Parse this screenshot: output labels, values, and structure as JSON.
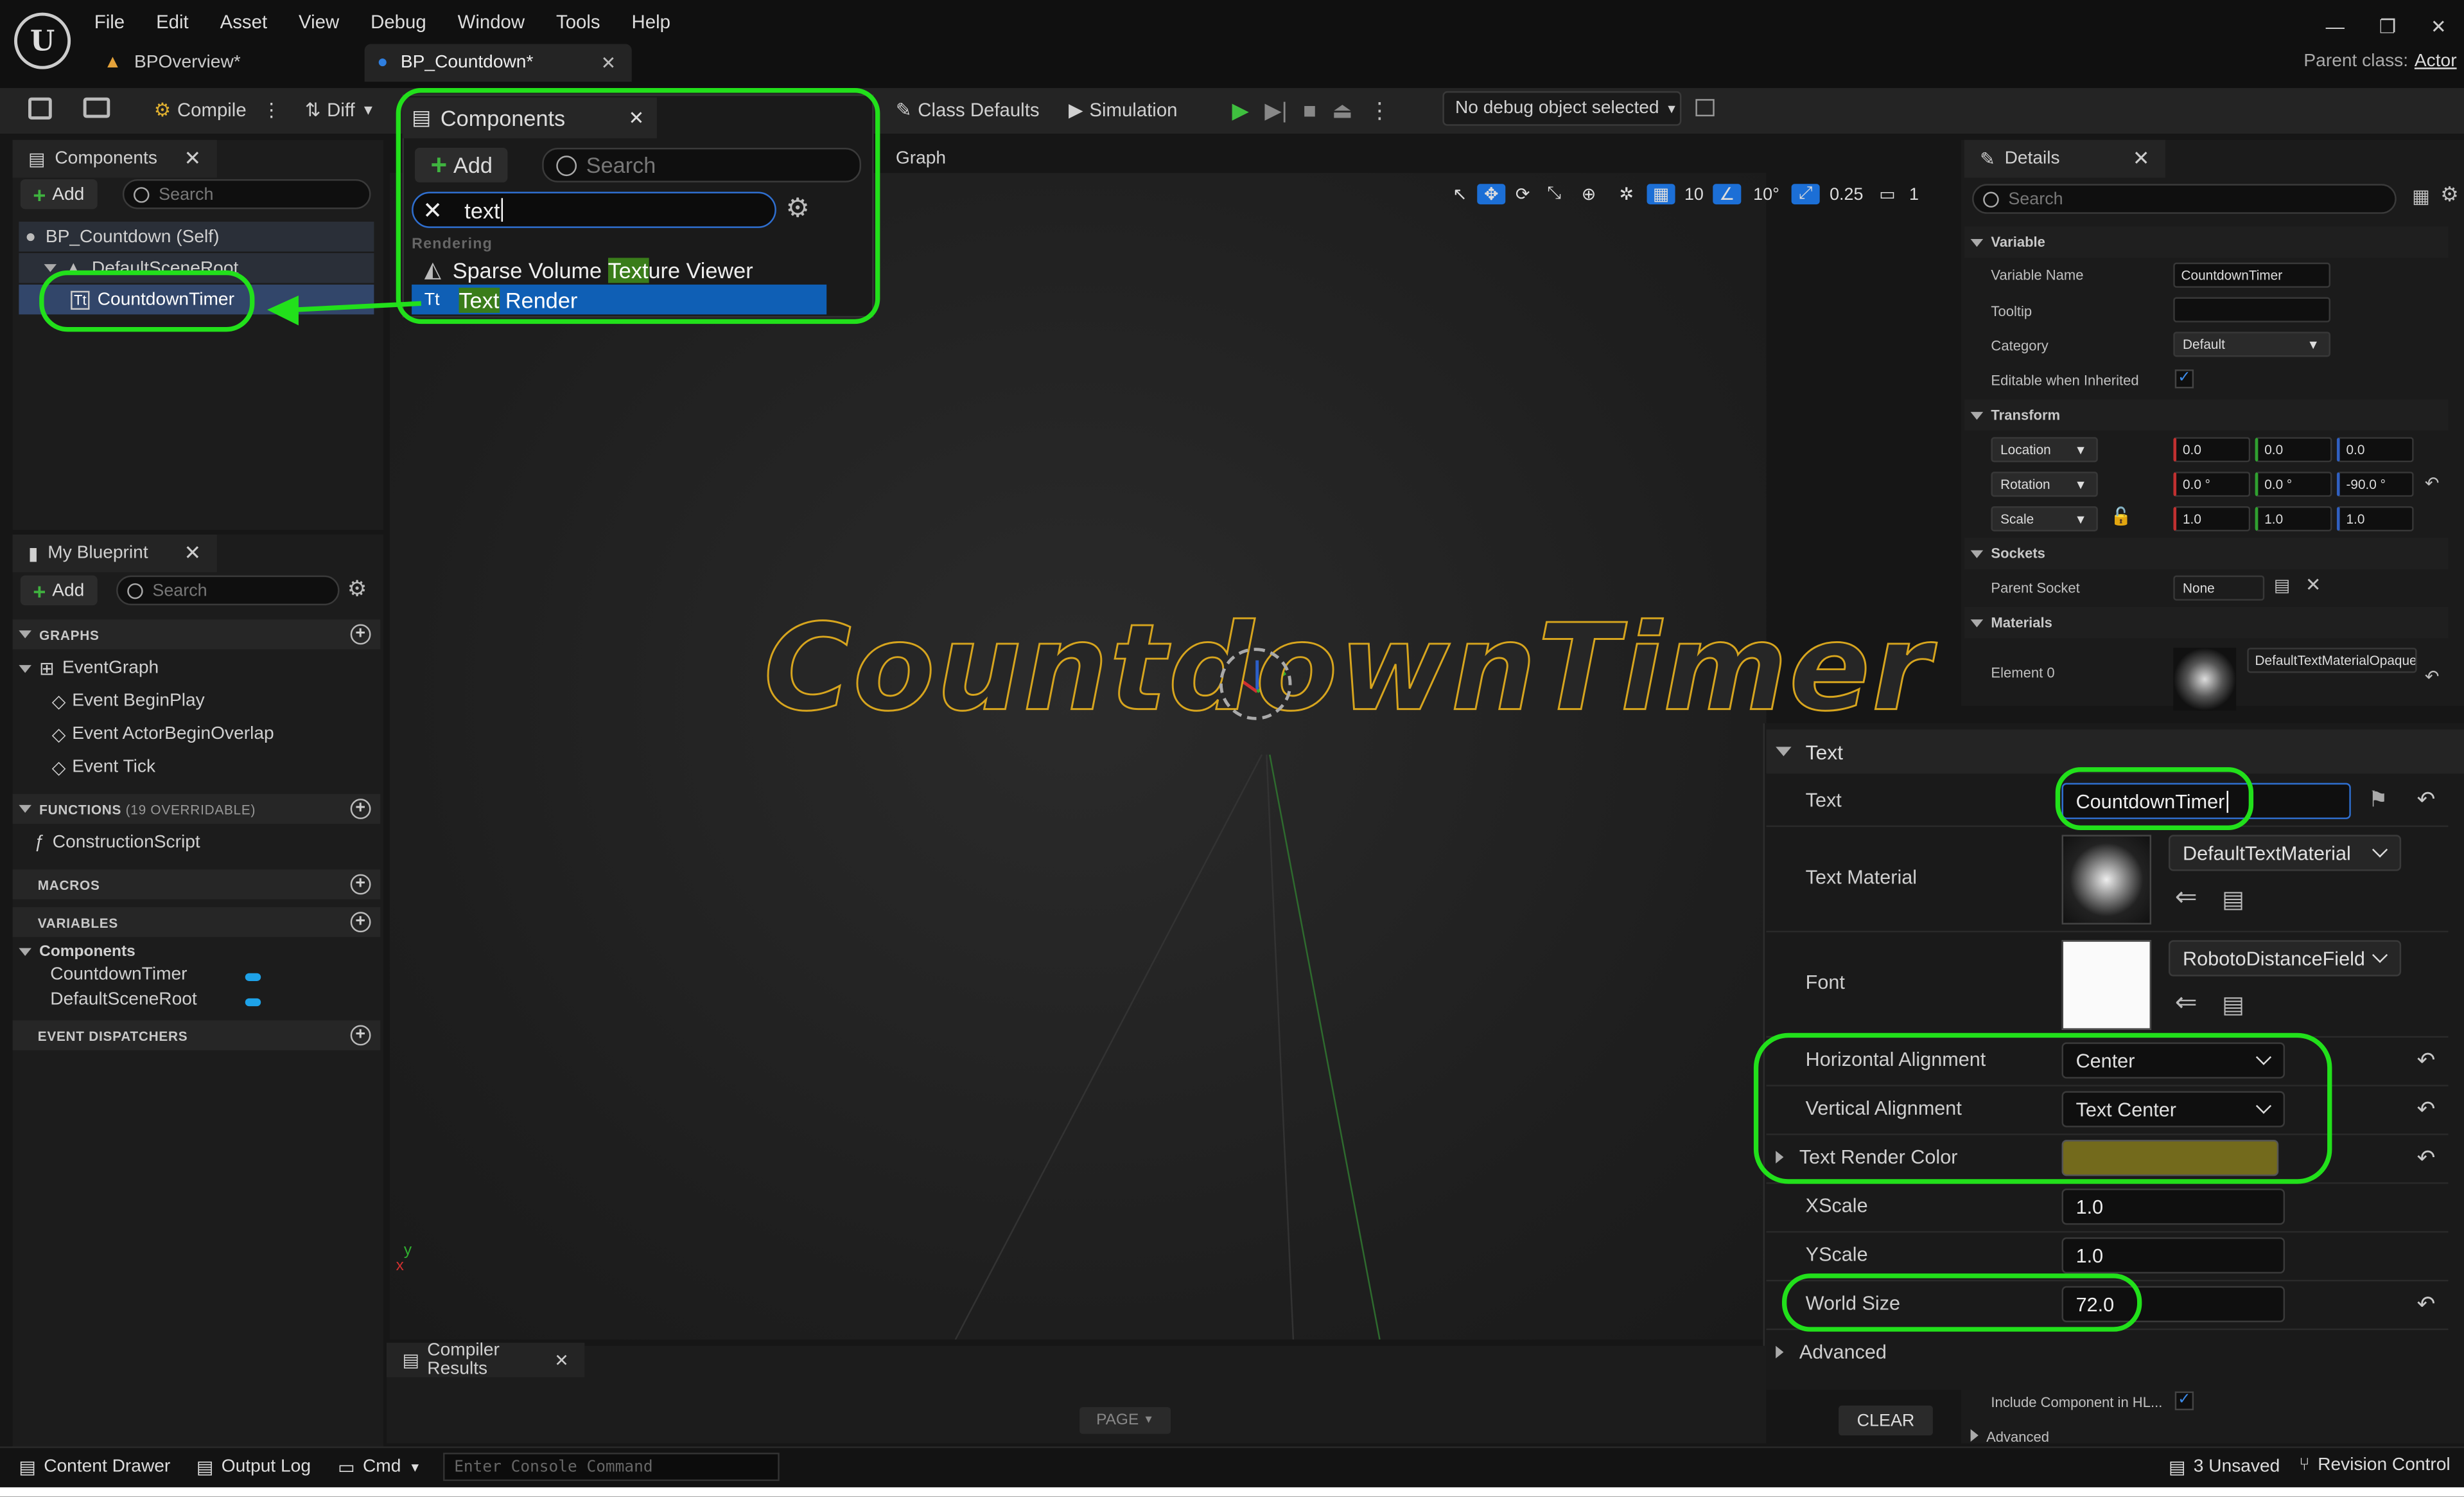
{
  "menu": [
    "File",
    "Edit",
    "Asset",
    "View",
    "Debug",
    "Window",
    "Tools",
    "Help"
  ],
  "tabs": [
    {
      "label": "BPOverview*"
    },
    {
      "label": "BP_Countdown*"
    }
  ],
  "parent_class": {
    "label": "Parent class:",
    "value": "Actor"
  },
  "toolbar": {
    "compile": "Compile",
    "diff": "Diff",
    "class_defaults": "Class Defaults",
    "simulation": "Simulation",
    "debug_object": "No debug object selected"
  },
  "viewport_toolbar": {
    "grid": "10",
    "angle": "10°",
    "scale": "0.25",
    "camera": "1"
  },
  "graph_tab_label": "Graph",
  "components_panel": {
    "title": "Components",
    "add": "Add",
    "search_placeholder": "Search",
    "items": [
      {
        "label": "BP_Countdown (Self)"
      },
      {
        "label": "DefaultSceneRoot"
      },
      {
        "label": "CountdownTimer"
      }
    ]
  },
  "add_popup": {
    "title": "Components",
    "add": "Add",
    "search_placeholder": "Search",
    "filter_text": "text",
    "category": "Rendering",
    "results": [
      {
        "pre": "Sparse Volume ",
        "match": "Text",
        "post": "ure Viewer"
      },
      {
        "pre": "",
        "match": "Text",
        "post": " Render"
      }
    ]
  },
  "my_blueprint": {
    "title": "My Blueprint",
    "add": "Add",
    "search_placeholder": "Search",
    "graphs_header": "GRAPHS",
    "event_graph": "EventGraph",
    "events": [
      "Event BeginPlay",
      "Event ActorBeginOverlap",
      "Event Tick"
    ],
    "functions_header": "FUNCTIONS",
    "functions_count": "(19 OVERRIDABLE)",
    "construction_script": "ConstructionScript",
    "macros_header": "MACROS",
    "variables_header": "VARIABLES",
    "components_header": "Components",
    "variables": [
      "CountdownTimer",
      "DefaultSceneRoot"
    ],
    "dispatchers_header": "EVENT DISPATCHERS"
  },
  "viewport_text": "CountdownTimer",
  "details": {
    "title": "Details",
    "search_placeholder": "Search",
    "variable_header": "Variable",
    "variable_name_label": "Variable Name",
    "variable_name": "CountdownTimer",
    "tooltip_label": "Tooltip",
    "category_label": "Category",
    "category": "Default",
    "editable_label": "Editable when Inherited",
    "transform_header": "Transform",
    "location_label": "Location",
    "location": [
      "0.0",
      "0.0",
      "0.0"
    ],
    "rotation_label": "Rotation",
    "rotation": [
      "0.0 °",
      "0.0 °",
      "-90.0 °"
    ],
    "scale_label": "Scale",
    "scale": [
      "1.0",
      "1.0",
      "1.0"
    ],
    "sockets_header": "Sockets",
    "parent_socket_label": "Parent Socket",
    "parent_socket": "None",
    "materials_header": "Materials",
    "element0_label": "Element 0",
    "element0": "DefaultTextMaterialOpaque",
    "include_label": "Include Component in HL...",
    "advanced": "Advanced"
  },
  "text_props": {
    "header": "Text",
    "text_label": "Text",
    "text_value": "CountdownTimer",
    "material_label": "Text Material",
    "material": "DefaultTextMaterial",
    "font_label": "Font",
    "font": "RobotoDistanceField",
    "halign_label": "Horizontal Alignment",
    "halign": "Center",
    "valign_label": "Vertical Alignment",
    "valign": "Text Center",
    "color_label": "Text Render Color",
    "color": "#736a1c",
    "xscale_label": "XScale",
    "xscale": "1.0",
    "yscale_label": "YScale",
    "yscale": "1.0",
    "world_size_label": "World Size",
    "world_size": "72.0",
    "advanced": "Advanced"
  },
  "compiler": {
    "tab": "Compiler Results",
    "page": "PAGE",
    "clear": "CLEAR"
  },
  "status": {
    "content_drawer": "Content Drawer",
    "output_log": "Output Log",
    "cmd": "Cmd",
    "console_placeholder": "Enter Console Command",
    "unsaved": "3 Unsaved",
    "revision": "Revision Control"
  },
  "colors": {
    "accent_green": "#22e01b",
    "selection": "#0f5fb5",
    "text_yellow": "#d7a51e"
  }
}
